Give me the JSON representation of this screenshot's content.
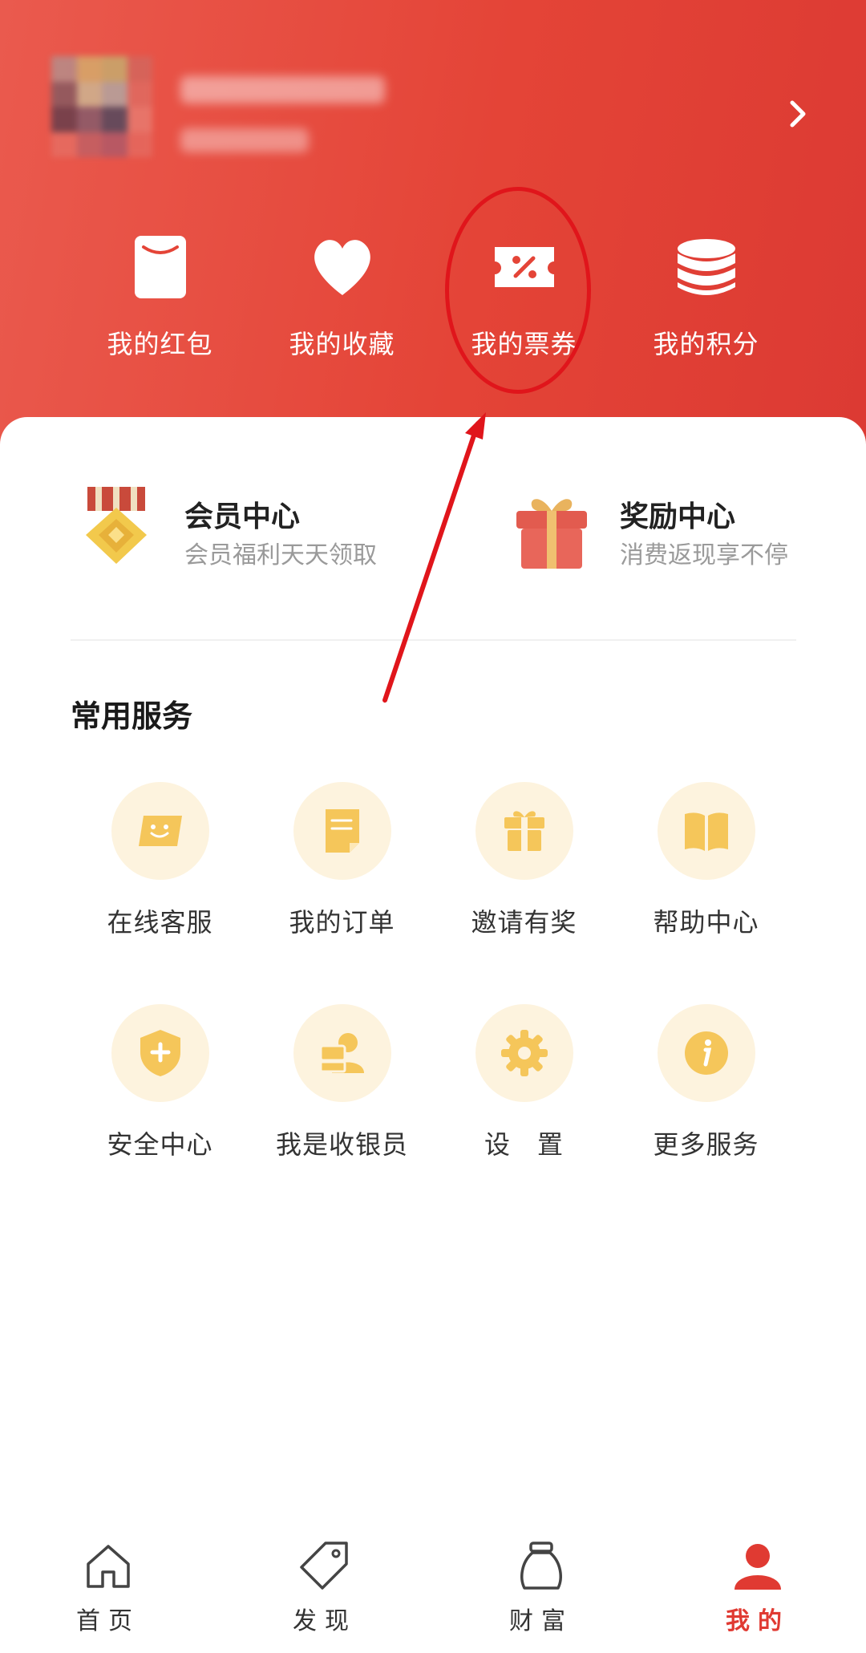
{
  "colors": {
    "brand_red": "#e44437",
    "accent_gold": "#f5c65a",
    "service_bg": "#fdf3de",
    "annotation_red": "#e0151b"
  },
  "header": {
    "avatar": "avatar-blurred",
    "profile_arrow_icon": "chevron-right-icon"
  },
  "quick_actions": [
    {
      "label": "我的红包",
      "icon": "red-packet-icon"
    },
    {
      "label": "我的收藏",
      "icon": "heart-icon"
    },
    {
      "label": "我的票券",
      "icon": "coupon-icon"
    },
    {
      "label": "我的积分",
      "icon": "coin-stack-icon"
    }
  ],
  "promos": [
    {
      "title": "会员中心",
      "subtitle": "会员福利天天领取",
      "icon": "medal-icon"
    },
    {
      "title": "奖励中心",
      "subtitle": "消费返现享不停",
      "icon": "gift-box-icon"
    }
  ],
  "services": {
    "title": "常用服务",
    "items": [
      {
        "label": "在线客服",
        "icon": "smile-ticket-icon"
      },
      {
        "label": "我的订单",
        "icon": "document-icon"
      },
      {
        "label": "邀请有奖",
        "icon": "gift-icon"
      },
      {
        "label": "帮助中心",
        "icon": "book-icon"
      },
      {
        "label": "安全中心",
        "icon": "shield-plus-icon"
      },
      {
        "label": "我是收银员",
        "icon": "cashier-icon"
      },
      {
        "label": "设　置",
        "icon": "gear-icon"
      },
      {
        "label": "更多服务",
        "icon": "info-icon"
      }
    ]
  },
  "tabbar": {
    "tabs": [
      {
        "label": "首页",
        "icon": "home-icon",
        "active": false
      },
      {
        "label": "发现",
        "icon": "tag-icon",
        "active": false
      },
      {
        "label": "财富",
        "icon": "money-bag-icon",
        "active": false
      },
      {
        "label": "我的",
        "icon": "person-icon",
        "active": true
      }
    ]
  }
}
